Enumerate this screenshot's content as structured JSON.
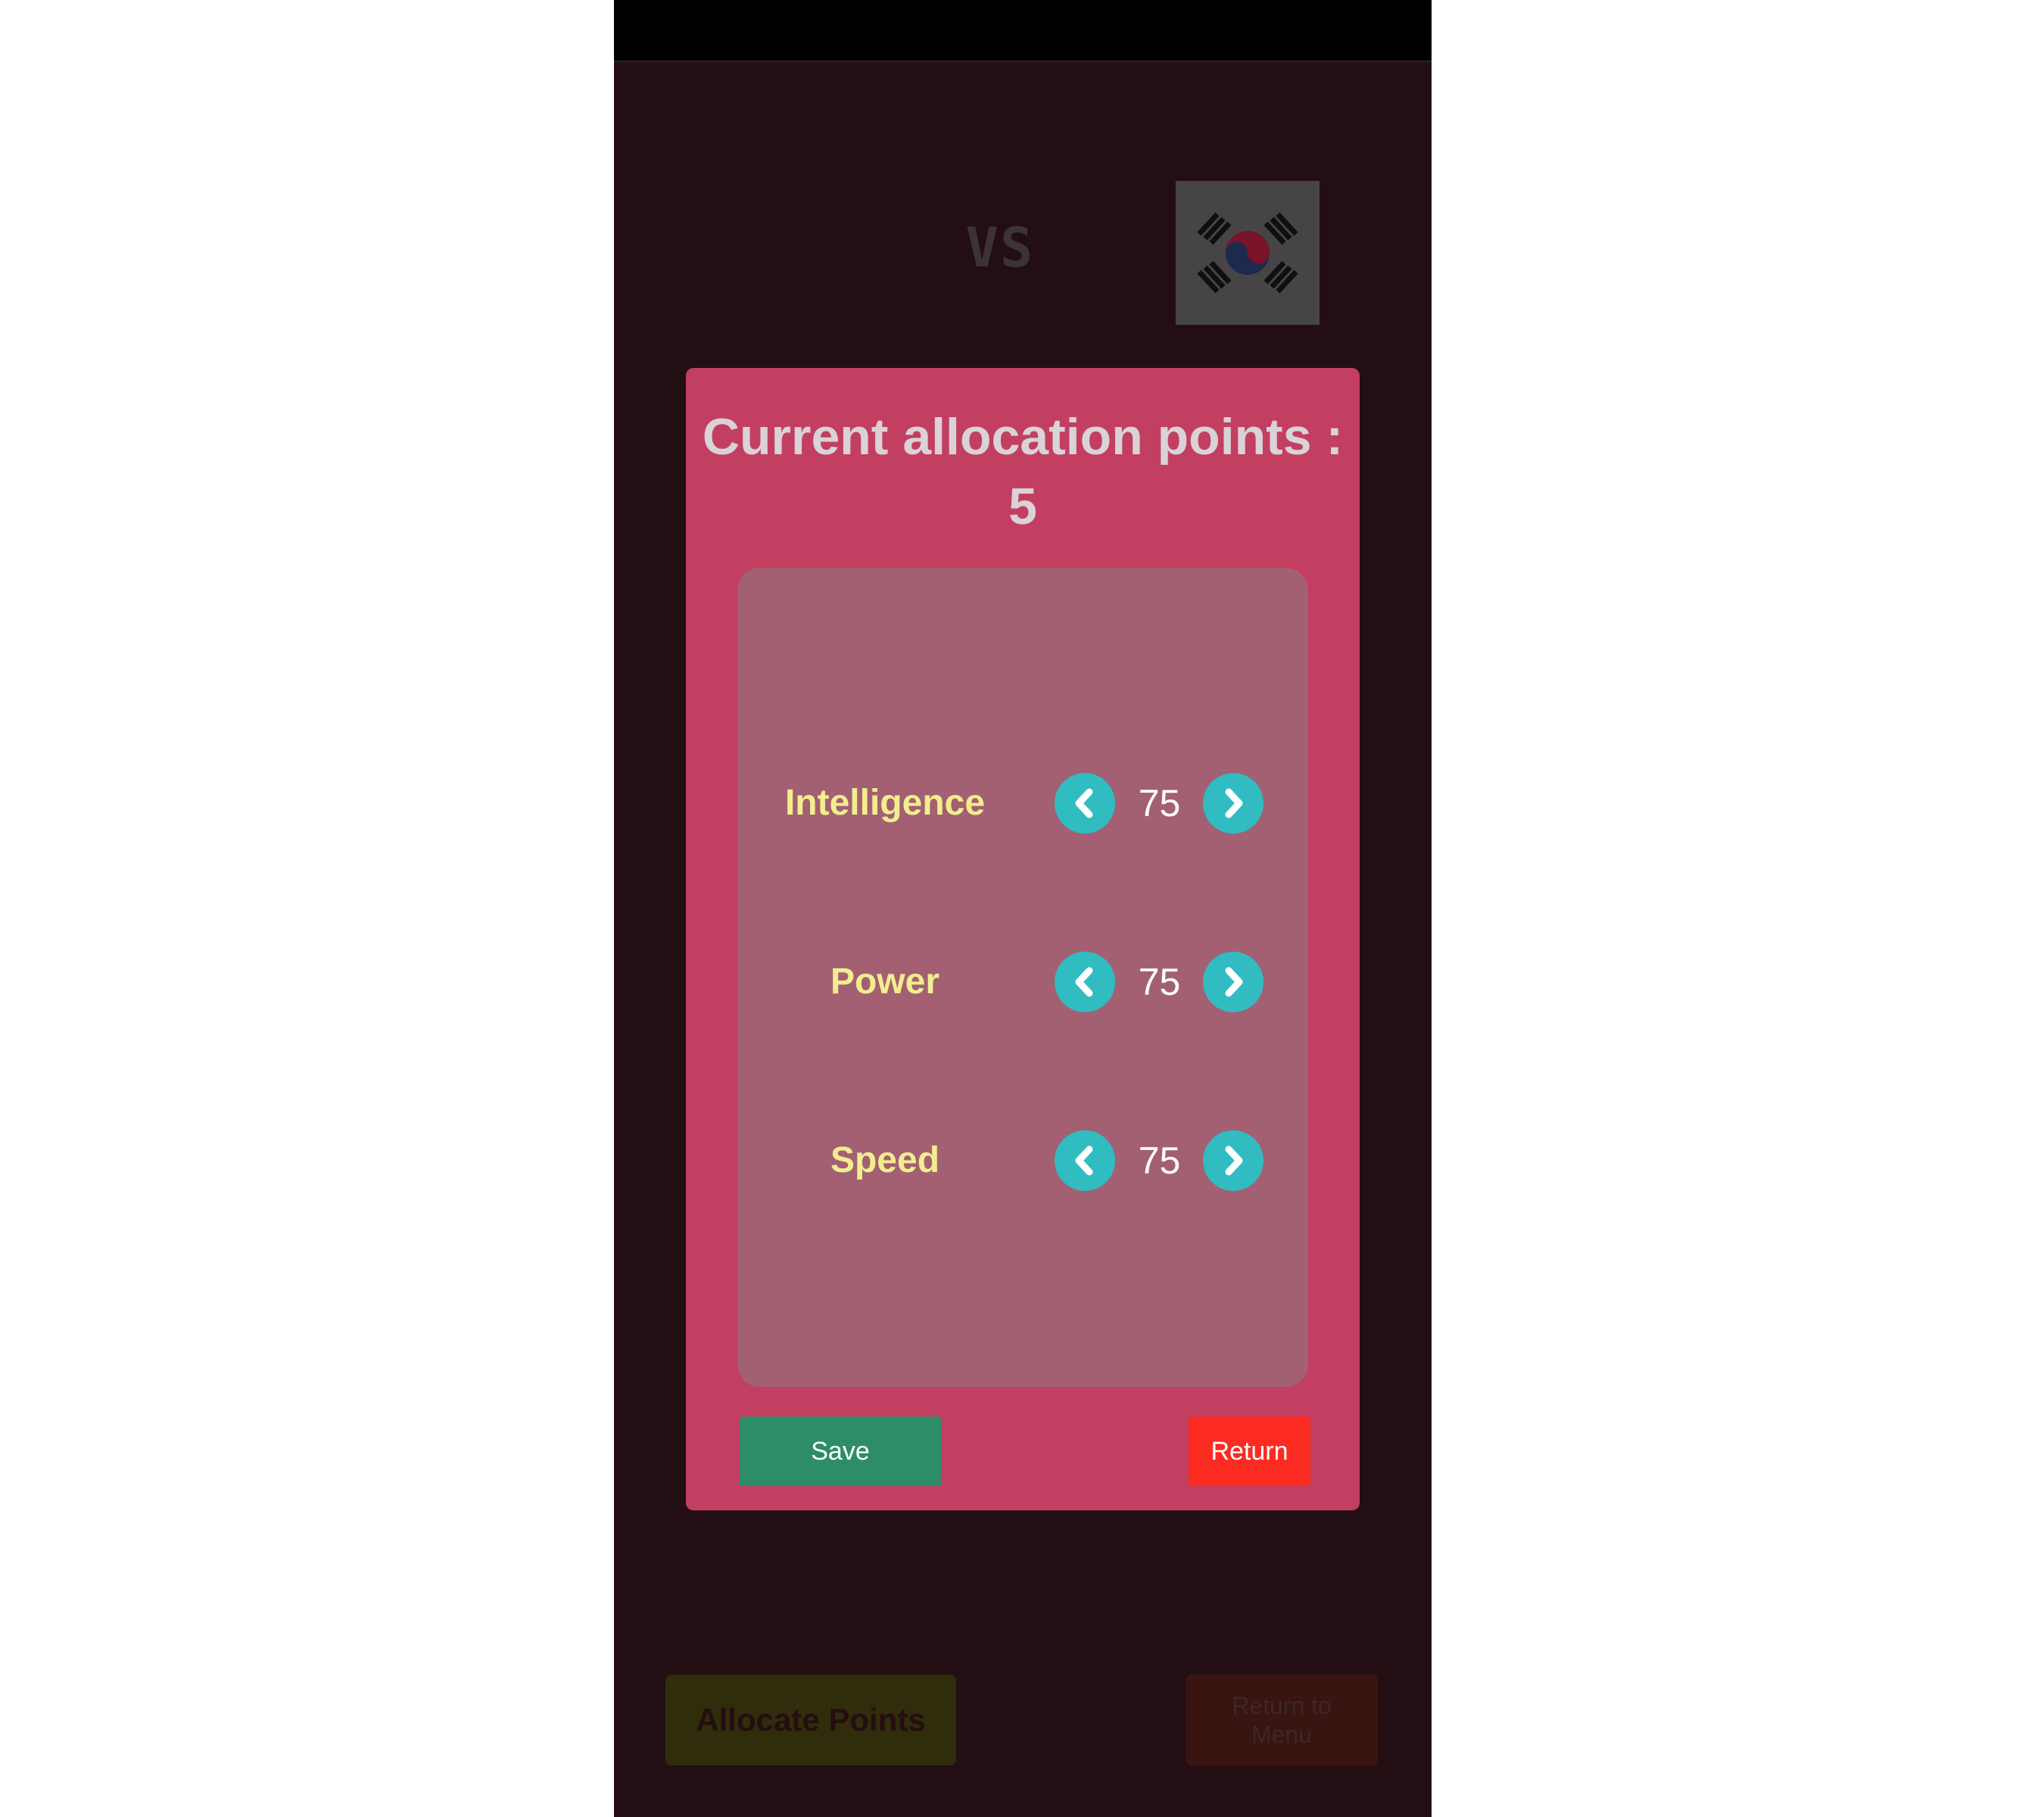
{
  "header": {
    "vs_text": "VS"
  },
  "opponent": {
    "flag": "south-korea-flag-icon"
  },
  "modal": {
    "title": "Current allocation points : 5",
    "stats": [
      {
        "label": "Intelligence",
        "value": "75"
      },
      {
        "label": "Power",
        "value": "75"
      },
      {
        "label": "Speed",
        "value": "75"
      }
    ],
    "save_label": "Save",
    "return_label": "Return"
  },
  "footer": {
    "allocate_label": "Allocate Points",
    "return_menu_label": "Return to\nMenu"
  },
  "colors": {
    "background": "#230e13",
    "modal": "#c23f62",
    "panel": "#a36072",
    "stat_label": "#f2ee8f",
    "arrow_button": "#30bcc1",
    "save": "#2e8d69",
    "return": "#fc2b21"
  }
}
